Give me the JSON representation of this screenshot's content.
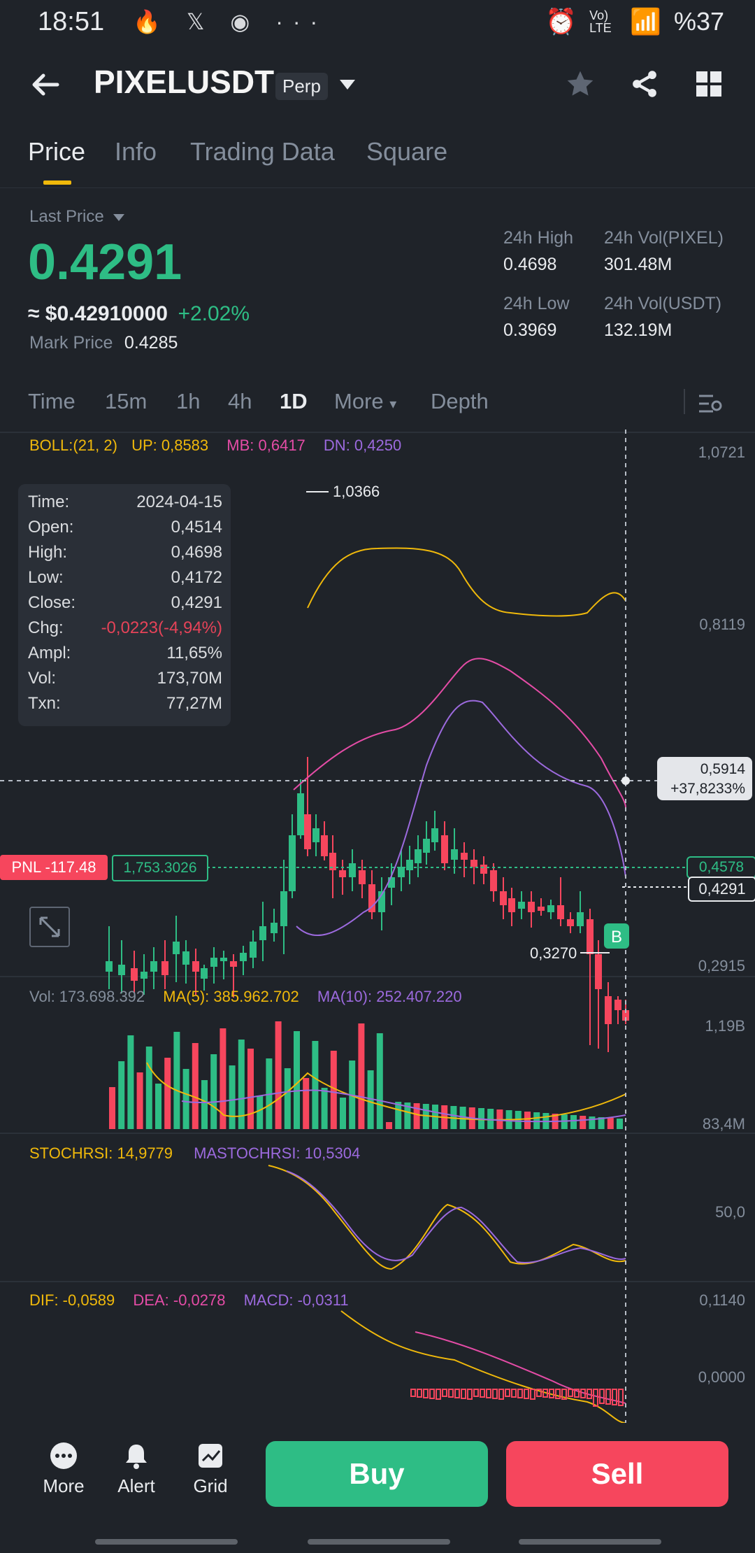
{
  "status_bar": {
    "time": "18:51",
    "battery": "%37",
    "network": "Vo) LTE"
  },
  "header": {
    "symbol": "PIXELUSDT",
    "badge": "Perp"
  },
  "tabs": [
    {
      "label": "Price"
    },
    {
      "label": "Info"
    },
    {
      "label": "Trading Data"
    },
    {
      "label": "Square"
    }
  ],
  "price": {
    "last_price_label": "Last Price",
    "last_price": "0.4291",
    "usd_equiv": "≈ $0.42910000",
    "change_pct": "+2.02%",
    "mark_price_label": "Mark Price",
    "mark_price": "0.4285",
    "high_label": "24h High",
    "high": "0.4698",
    "low_label": "24h Low",
    "low": "0.3969",
    "vol_base_label": "24h Vol(PIXEL)",
    "vol_base": "301.48M",
    "vol_quote_label": "24h Vol(USDT)",
    "vol_quote": "132.19M"
  },
  "timeframes": [
    {
      "label": "Time"
    },
    {
      "label": "15m"
    },
    {
      "label": "1h"
    },
    {
      "label": "4h"
    },
    {
      "label": "1D"
    },
    {
      "label": "More"
    },
    {
      "label": "Depth"
    }
  ],
  "boll": {
    "label": "BOLL:(21, 2)",
    "up": "UP: 0,8583",
    "mb": "MB: 0,6417",
    "dn": "DN: 0,4250"
  },
  "price_axis": [
    "1,0721",
    "0,8119",
    "0,2915"
  ],
  "annotations": {
    "high": "1,0366",
    "low": "0,3270",
    "crosshair_price": "0,5914",
    "crosshair_pct": "+37,8233%",
    "entry_line": "0,4578",
    "current": "0,4291",
    "pnl": "PNL -117.48",
    "entry_qty": "1,753.3026",
    "buy_marker": "B"
  },
  "ohlc": {
    "rows": [
      {
        "k": "Time:",
        "v": "2024-04-15"
      },
      {
        "k": "Open:",
        "v": "0,4514"
      },
      {
        "k": "High:",
        "v": "0,4698"
      },
      {
        "k": "Low:",
        "v": "0,4172"
      },
      {
        "k": "Close:",
        "v": "0,4291"
      },
      {
        "k": "Chg:",
        "v": "-0,0223(-4,94%)"
      },
      {
        "k": "Ampl:",
        "v": "11,65%"
      },
      {
        "k": "Vol:",
        "v": "173,70M"
      },
      {
        "k": "Txn:",
        "v": "77,27M"
      }
    ]
  },
  "volume": {
    "vol": "Vol: 173.698.392",
    "ma5": "MA(5): 385.962.702",
    "ma10": "MA(10): 252.407.220",
    "axis_top": "1,19B",
    "axis_bottom": "83,4M"
  },
  "stoch": {
    "k": "STOCHRSI: 14,9779",
    "d": "MASTOCHRSI: 10,5304",
    "axis": "50,0"
  },
  "macd": {
    "dif": "DIF: -0,0589",
    "dea": "DEA: -0,0278",
    "macd": "MACD: -0,0311",
    "axis_top": "0,1140",
    "axis_zero": "0,0000"
  },
  "bottom": {
    "more": "More",
    "alert": "Alert",
    "grid": "Grid",
    "buy": "Buy",
    "sell": "Sell"
  },
  "colors": {
    "up": "#2ebd85",
    "down": "#f6465d",
    "yellow": "#f0b90b",
    "pink": "#e44ca6",
    "purple": "#9c6ade",
    "bg": "#1f2329"
  }
}
